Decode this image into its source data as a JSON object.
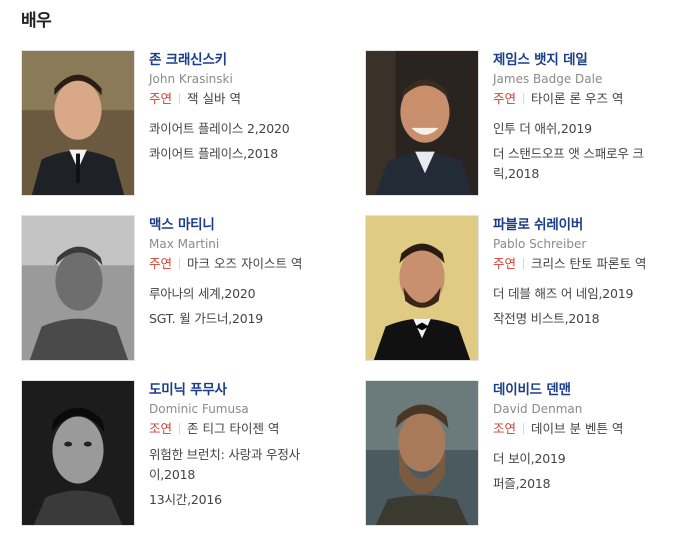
{
  "section": {
    "title": "배우"
  },
  "colors": {
    "name": "#1a3d8a",
    "role_type": "#d2402f",
    "english": "#8a8a8a"
  },
  "actors": [
    {
      "name": "존 크래신스키",
      "english_name": "John Krasinski",
      "role_type": "주연",
      "role": "잭 실바 역",
      "works": [
        "콰이어트 플레이스 2,2020",
        "콰이어트 플레이스,2018"
      ]
    },
    {
      "name": "제임스 뱃지 데일",
      "english_name": "James Badge Dale",
      "role_type": "주연",
      "role": "타이론 론 우즈 역",
      "works": [
        "인투 더 애쉬,2019",
        "더 스탠드오프 앳 스패로우 크릭,2018"
      ]
    },
    {
      "name": "맥스 마티니",
      "english_name": "Max Martini",
      "role_type": "주연",
      "role": "마크 오즈 자이스트 역",
      "works": [
        "루아나의 세계,2020",
        "SGT. 윌 가드너,2019"
      ]
    },
    {
      "name": "파블로 쉬레이버",
      "english_name": "Pablo Schreiber",
      "role_type": "주연",
      "role": "크리스 탄토 파론토 역",
      "works": [
        "더 데블 해즈 어 네임,2019",
        "작전명 비스트,2018"
      ]
    },
    {
      "name": "도미닉 푸무사",
      "english_name": "Dominic Fumusa",
      "role_type": "조연",
      "role": "존 티그 타이젠 역",
      "works": [
        "위험한 브런치: 사랑과 우정사이,2018",
        "13시간,2016"
      ]
    },
    {
      "name": "데이비드 덴맨",
      "english_name": "David Denman",
      "role_type": "조연",
      "role": "데이브 분 벤튼 역",
      "works": [
        "더 보이,2019",
        "퍼즐,2018"
      ]
    }
  ]
}
